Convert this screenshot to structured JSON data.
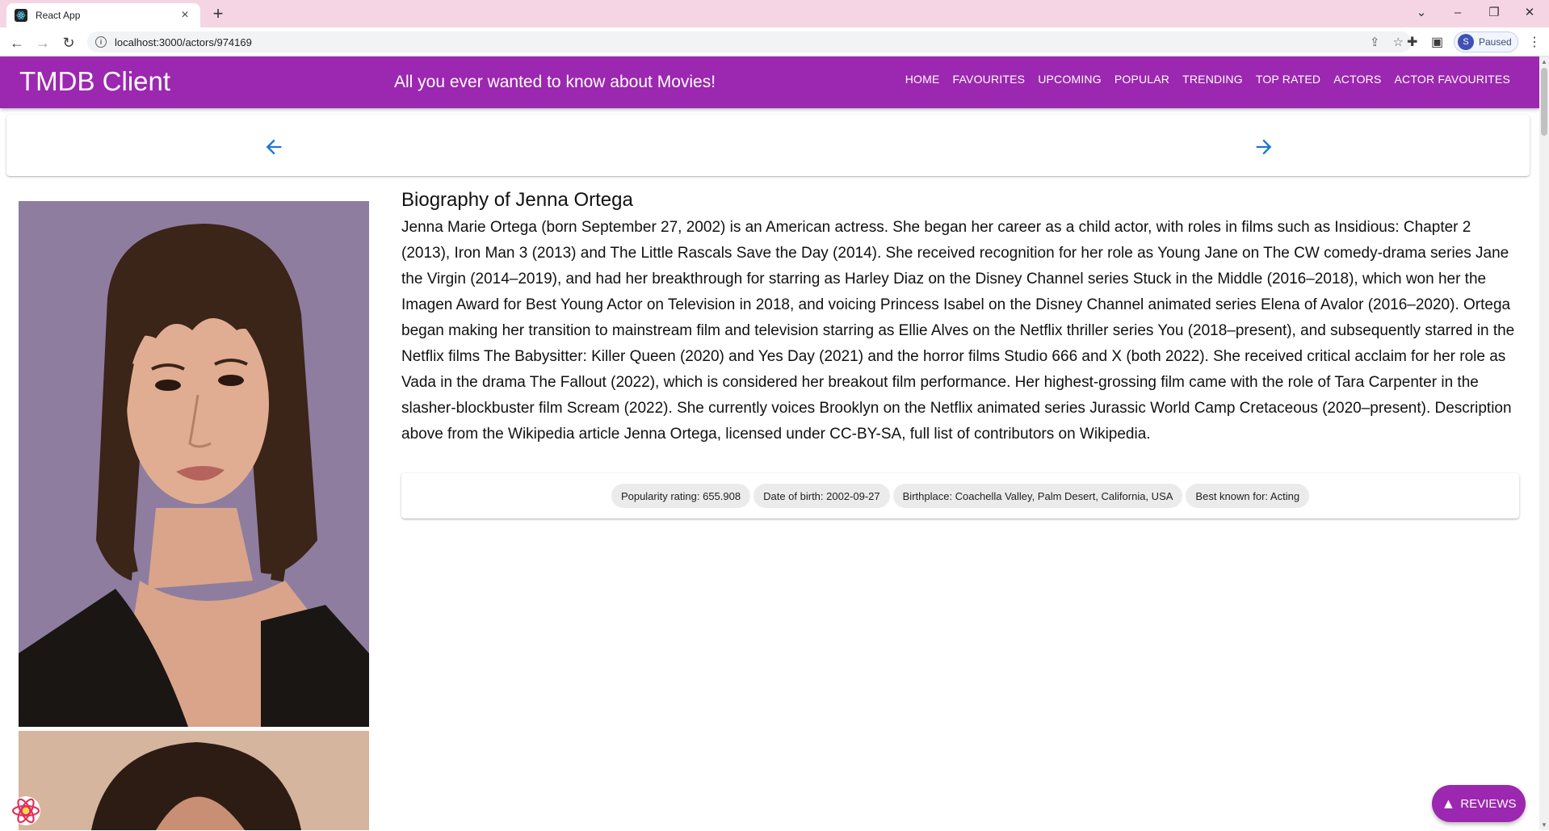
{
  "browser": {
    "tab_title": "React App",
    "url": "localhost:3000/actors/974169",
    "profile_initial": "S",
    "profile_status": "Paused"
  },
  "header": {
    "title": "TMDB Client",
    "tagline": "All you ever wanted to know about Movies!",
    "nav": [
      "HOME",
      "FAVOURITES",
      "UPCOMING",
      "POPULAR",
      "TRENDING",
      "TOP RATED",
      "ACTORS",
      "ACTOR FAVOURITES"
    ]
  },
  "actor": {
    "bio_heading": "Biography of Jenna Ortega",
    "biography": "Jenna Marie Ortega (born September 27, 2002) is an American actress. She began her career as a child actor, with roles in films such as Insidious: Chapter 2 (2013), Iron Man 3 (2013) and The Little Rascals Save the Day (2014). She received recognition for her role as Young Jane on The CW comedy-drama series Jane the Virgin (2014–2019), and had her breakthrough for starring as Harley Diaz on the Disney Channel series Stuck in the Middle (2016–2018), which won her the Imagen Award for Best Young Actor on Television in 2018, and voicing Princess Isabel on the Disney Channel animated series Elena of Avalor (2016–2020). Ortega began making her transition to mainstream film and television starring as Ellie Alves on the Netflix thriller series You (2018–present), and subsequently starred in the Netflix films The Babysitter: Killer Queen (2020) and Yes Day (2021) and the horror films Studio 666 and X (both 2022). She received critical acclaim for her role as Vada in the drama The Fallout (2022), which is considered her breakout film performance. Her highest-grossing film came with the role of Tara Carpenter in the slasher-blockbuster film Scream (2022). She currently voices Brooklyn on the Netflix animated series Jurassic World Camp Cretaceous (2020–present). Description above from the Wikipedia article Jenna Ortega, licensed under CC-BY-SA, full list of contributors on Wikipedia.",
    "chips": [
      "Popularity rating: 655.908",
      "Date of birth: 2002-09-27",
      "Birthplace: Coachella Valley, Palm Desert, California, USA",
      "Best known for: Acting"
    ]
  },
  "fab": {
    "label": "REVIEWS"
  },
  "colors": {
    "primary": "#9c27b0",
    "arrow": "#1976d2",
    "tabbar": "#f5d5e4"
  }
}
